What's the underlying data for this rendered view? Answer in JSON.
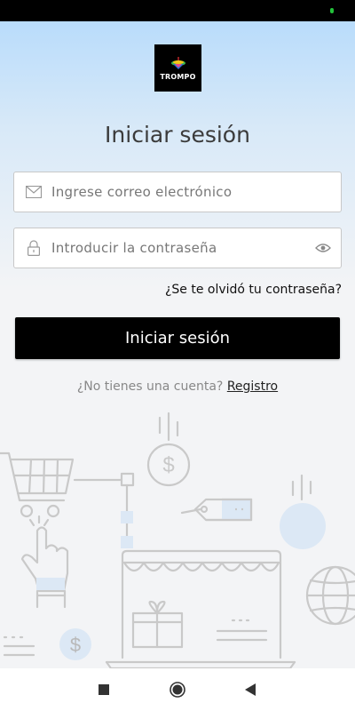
{
  "app": {
    "logo_text": "TROMPO"
  },
  "login": {
    "title": "Iniciar sesión",
    "email_placeholder": "Ingrese correo electrónico",
    "password_placeholder": "Introducir la contraseña",
    "forgot_password": "¿Se te olvidó tu contraseña?",
    "submit_label": "Iniciar sesión",
    "no_account_text": "¿No tienes una cuenta?",
    "register_link": "Registro"
  },
  "illustration": {
    "price_symbol": "$"
  },
  "icons": {
    "email": "envelope-icon",
    "password": "lock-icon",
    "toggle_visibility": "eye-icon",
    "nav_recent": "square-icon",
    "nav_home": "circle-icon",
    "nav_back": "triangle-back-icon"
  },
  "colors": {
    "primary_button": "#000000",
    "hero_gradient_top": "#b9dcfb",
    "background": "#f3f4f6",
    "illustration_stroke": "#c9c9c9",
    "illustration_accent": "#dce8f5"
  }
}
